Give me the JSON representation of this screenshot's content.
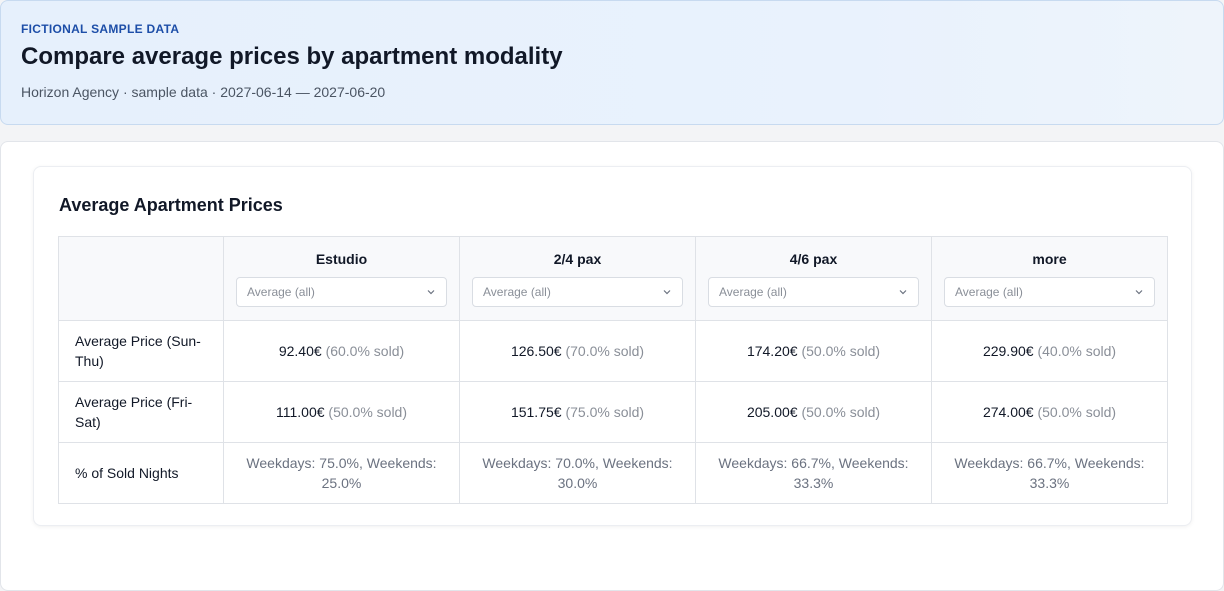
{
  "header": {
    "eyebrow": "FICTIONAL SAMPLE DATA",
    "title": "Compare average prices by apartment modality",
    "subtitle": "Horizon Agency · sample data · 2027-06-14 — 2027-06-20"
  },
  "card": {
    "title": "Average Apartment Prices"
  },
  "table": {
    "columns": [
      {
        "name": "Estudio",
        "select": "Average (all)"
      },
      {
        "name": "2/4 pax",
        "select": "Average (all)"
      },
      {
        "name": "4/6 pax",
        "select": "Average (all)"
      },
      {
        "name": "more",
        "select": "Average (all)"
      }
    ],
    "rows": {
      "weekday": {
        "label": "Average Price (Sun-Thu)",
        "cells": [
          {
            "price": "92.40€",
            "sold": "(60.0% sold)"
          },
          {
            "price": "126.50€",
            "sold": "(70.0% sold)"
          },
          {
            "price": "174.20€",
            "sold": "(50.0% sold)"
          },
          {
            "price": "229.90€",
            "sold": "(40.0% sold)"
          }
        ]
      },
      "weekend": {
        "label": "Average Price (Fri-Sat)",
        "cells": [
          {
            "price": "111.00€",
            "sold": "(50.0% sold)"
          },
          {
            "price": "151.75€",
            "sold": "(75.0% sold)"
          },
          {
            "price": "205.00€",
            "sold": "(50.0% sold)"
          },
          {
            "price": "274.00€",
            "sold": "(50.0% sold)"
          }
        ]
      },
      "sold_nights": {
        "label": "% of Sold Nights",
        "cells": [
          "Weekdays: 75.0%, Weekends: 25.0%",
          "Weekdays: 70.0%, Weekends: 30.0%",
          "Weekdays: 66.7%, Weekends: 33.3%",
          "Weekdays: 66.7%, Weekends: 33.3%"
        ]
      }
    }
  },
  "icons": {
    "select_arrow": "chevron-down-icon"
  },
  "colors": {
    "accent": "#1d4ea8",
    "header_bg": "#e7f0fc",
    "muted": "#8a8f98"
  }
}
